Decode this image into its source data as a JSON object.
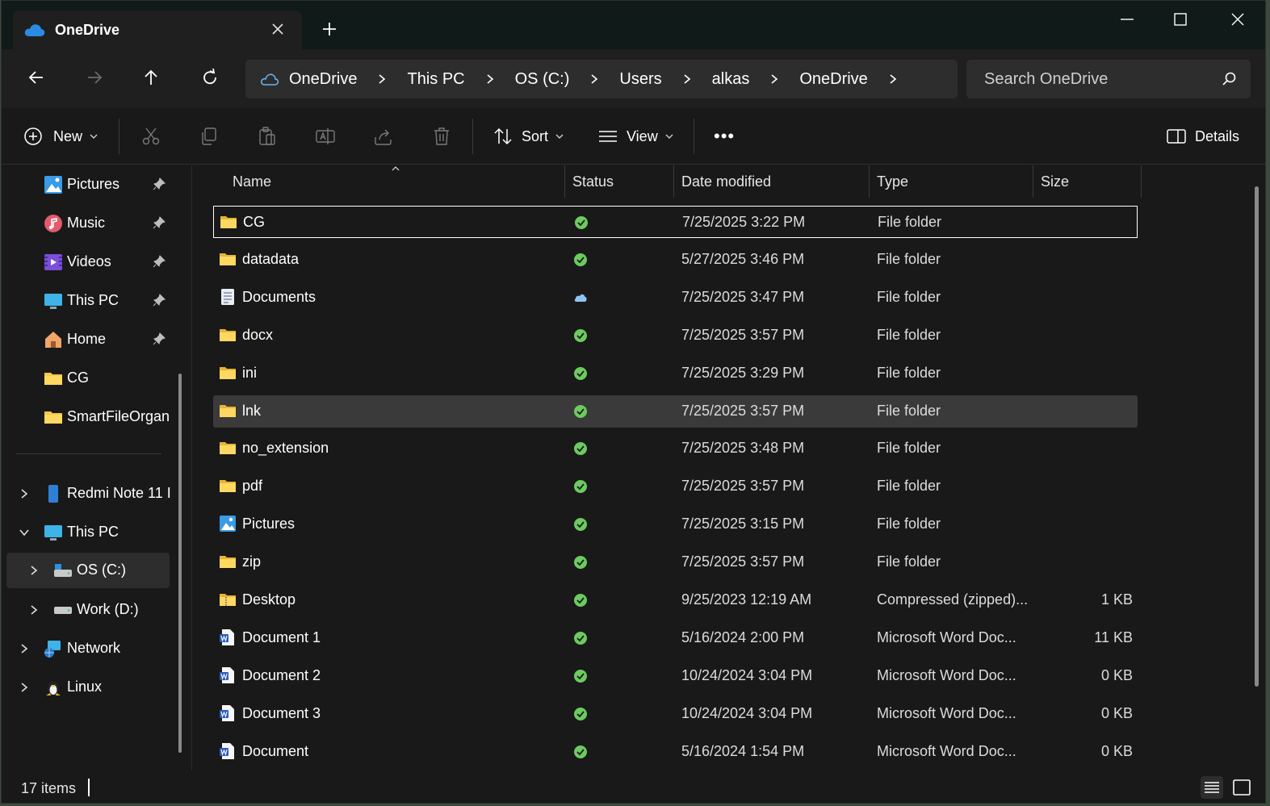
{
  "window": {
    "tab_title": "OneDrive",
    "controls": [
      "minimize-icon",
      "maximize-icon",
      "close-icon"
    ]
  },
  "nav": {
    "breadcrumb": [
      "OneDrive",
      "This PC",
      "OS (C:)",
      "Users",
      "alkas",
      "OneDrive"
    ],
    "search_placeholder": "Search OneDrive"
  },
  "toolbar": {
    "new_label": "New",
    "sort_label": "Sort",
    "view_label": "View",
    "details_label": "Details",
    "more_label": "•••"
  },
  "sidebar": {
    "quick_access": [
      {
        "label": "Pictures",
        "icon": "pictures-icon",
        "pinned": true
      },
      {
        "label": "Music",
        "icon": "music-icon",
        "pinned": true
      },
      {
        "label": "Videos",
        "icon": "videos-icon",
        "pinned": true
      },
      {
        "label": "This PC",
        "icon": "pc-icon",
        "pinned": true
      },
      {
        "label": "Home",
        "icon": "home-icon",
        "pinned": true
      },
      {
        "label": "CG",
        "icon": "folder-icon",
        "pinned": false
      },
      {
        "label": "SmartFileOrgani",
        "icon": "folder-icon",
        "pinned": false
      }
    ],
    "tree": [
      {
        "label": "Redmi Note 11 I",
        "icon": "phone-icon",
        "expanded": false,
        "level": 0
      },
      {
        "label": "This PC",
        "icon": "pc-icon",
        "expanded": true,
        "level": 0
      },
      {
        "label": "OS (C:)",
        "icon": "drive-c-icon",
        "expanded": false,
        "level": 1,
        "selected": true
      },
      {
        "label": "Work (D:)",
        "icon": "drive-icon",
        "expanded": false,
        "level": 1
      },
      {
        "label": "Network",
        "icon": "network-icon",
        "expanded": false,
        "level": 0
      },
      {
        "label": "Linux",
        "icon": "linux-icon",
        "expanded": false,
        "level": 0
      }
    ]
  },
  "columns": {
    "name": "Name",
    "status": "Status",
    "date": "Date modified",
    "type": "Type",
    "size": "Size"
  },
  "files": [
    {
      "name": "CG",
      "icon": "folder",
      "status": "synced",
      "date": "7/25/2025 3:22 PM",
      "type": "File folder",
      "size": ""
    },
    {
      "name": "datadata",
      "icon": "folder",
      "status": "synced",
      "date": "5/27/2025 3:46 PM",
      "type": "File folder",
      "size": ""
    },
    {
      "name": "Documents",
      "icon": "documents",
      "status": "cloud",
      "date": "7/25/2025 3:47 PM",
      "type": "File folder",
      "size": ""
    },
    {
      "name": "docx",
      "icon": "folder",
      "status": "synced",
      "date": "7/25/2025 3:57 PM",
      "type": "File folder",
      "size": ""
    },
    {
      "name": "ini",
      "icon": "folder",
      "status": "synced",
      "date": "7/25/2025 3:29 PM",
      "type": "File folder",
      "size": ""
    },
    {
      "name": "lnk",
      "icon": "folder",
      "status": "synced",
      "date": "7/25/2025 3:57 PM",
      "type": "File folder",
      "size": ""
    },
    {
      "name": "no_extension",
      "icon": "folder",
      "status": "synced",
      "date": "7/25/2025 3:48 PM",
      "type": "File folder",
      "size": ""
    },
    {
      "name": "pdf",
      "icon": "folder",
      "status": "synced",
      "date": "7/25/2025 3:57 PM",
      "type": "File folder",
      "size": ""
    },
    {
      "name": "Pictures",
      "icon": "pictures",
      "status": "synced",
      "date": "7/25/2025 3:15 PM",
      "type": "File folder",
      "size": ""
    },
    {
      "name": "zip",
      "icon": "folder",
      "status": "synced",
      "date": "7/25/2025 3:57 PM",
      "type": "File folder",
      "size": ""
    },
    {
      "name": "Desktop",
      "icon": "zip",
      "status": "synced",
      "date": "9/25/2023 12:19 AM",
      "type": "Compressed (zipped)...",
      "size": "1 KB"
    },
    {
      "name": "Document 1",
      "icon": "word",
      "status": "synced",
      "date": "5/16/2024 2:00 PM",
      "type": "Microsoft Word Doc...",
      "size": "11 KB"
    },
    {
      "name": "Document 2",
      "icon": "word",
      "status": "synced",
      "date": "10/24/2024 3:04 PM",
      "type": "Microsoft Word Doc...",
      "size": "0 KB"
    },
    {
      "name": "Document 3",
      "icon": "word",
      "status": "synced",
      "date": "10/24/2024 3:04 PM",
      "type": "Microsoft Word Doc...",
      "size": "0 KB"
    },
    {
      "name": "Document",
      "icon": "word",
      "status": "synced",
      "date": "5/16/2024 1:54 PM",
      "type": "Microsoft Word Doc...",
      "size": "0 KB"
    }
  ],
  "statusbar": {
    "item_count": "17 items"
  },
  "colors": {
    "background": "#191919",
    "folder": "#f7c948",
    "synced_green": "#6ccb5f",
    "cloud_blue": "#8fc3f0",
    "hover_row": "#3a3a3a"
  }
}
